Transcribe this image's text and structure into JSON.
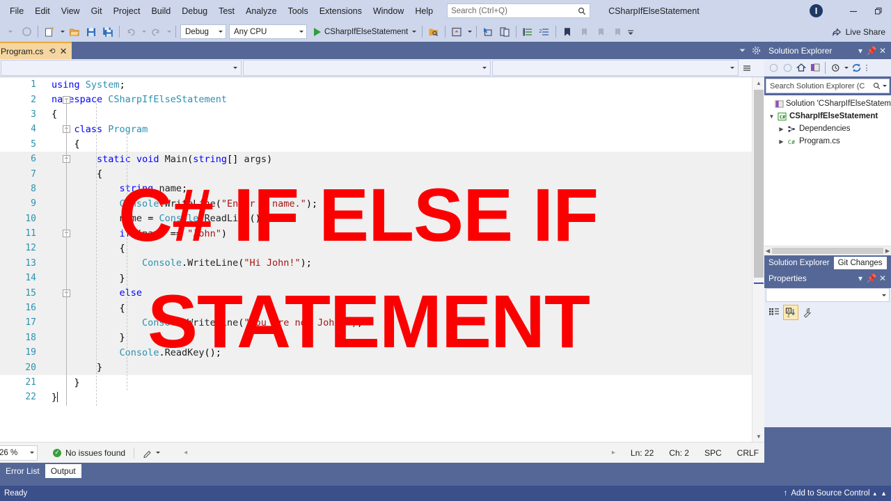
{
  "titlebar": {
    "menus": [
      "File",
      "Edit",
      "View",
      "Git",
      "Project",
      "Build",
      "Debug",
      "Test",
      "Analyze",
      "Tools",
      "Extensions",
      "Window",
      "Help"
    ],
    "search_placeholder": "Search (Ctrl+Q)",
    "solution_title": "CSharpIfElseStatement",
    "avatar_initial": "I",
    "minimize_label": "Minimize",
    "restore_label": "Restore Down"
  },
  "toolbar": {
    "config": "Debug",
    "platform": "Any CPU",
    "run_target": "CSharpIfElseStatement",
    "live_share": "Live Share"
  },
  "editor": {
    "tab_name": "Program.cs",
    "tab_pin": "⟲",
    "tab_close": "✕",
    "breadcrumb": {
      "scope": "",
      "type": "",
      "member": ""
    },
    "caret": "|",
    "lines": [
      {
        "n": "1",
        "text": "using System;",
        "hl": false
      },
      {
        "n": "2",
        "text": "namespace CSharpIfElseStatement",
        "hl": false
      },
      {
        "n": "3",
        "text": "{",
        "hl": false
      },
      {
        "n": "4",
        "text": "    class Program",
        "hl": false
      },
      {
        "n": "5",
        "text": "    {",
        "hl": false
      },
      {
        "n": "6",
        "text": "        static void Main(string[] args)",
        "hl": true
      },
      {
        "n": "7",
        "text": "        {",
        "hl": true
      },
      {
        "n": "8",
        "text": "            string name;",
        "hl": true
      },
      {
        "n": "9",
        "text": "            Console.WriteLine(\"Enter a name.\");",
        "hl": true
      },
      {
        "n": "10",
        "text": "            name = Console.ReadLine();",
        "hl": true
      },
      {
        "n": "11",
        "text": "            if (name == \"John\")",
        "hl": true
      },
      {
        "n": "12",
        "text": "            {",
        "hl": true
      },
      {
        "n": "13",
        "text": "                Console.WriteLine(\"Hi John!\");",
        "hl": true
      },
      {
        "n": "14",
        "text": "            }",
        "hl": true
      },
      {
        "n": "15",
        "text": "            else",
        "hl": true
      },
      {
        "n": "16",
        "text": "            {",
        "hl": true
      },
      {
        "n": "17",
        "text": "                Console.WriteLine(\"You are not John!\");",
        "hl": true
      },
      {
        "n": "18",
        "text": "            }",
        "hl": true
      },
      {
        "n": "19",
        "text": "            Console.ReadKey();",
        "hl": true
      },
      {
        "n": "20",
        "text": "        }",
        "hl": true
      },
      {
        "n": "21",
        "text": "    }",
        "hl": false
      },
      {
        "n": "22",
        "text": "}",
        "hl": false
      }
    ]
  },
  "editor_status": {
    "zoom": "26 %",
    "issues": "No issues found",
    "line": "Ln: 22",
    "column": "Ch: 2",
    "indent": "SPC",
    "eol": "CRLF"
  },
  "solution_explorer": {
    "title": "Solution Explorer",
    "search_placeholder": "Search Solution Explorer (C",
    "nodes": [
      {
        "label": "Solution 'CSharpIfElseStatem",
        "icon": "solution-icon",
        "depth": 0,
        "twisty": "",
        "bold": false
      },
      {
        "label": "CSharpIfElseStatement",
        "icon": "csharp-project-icon",
        "depth": 0,
        "twisty": "▼",
        "bold": true
      },
      {
        "label": "Dependencies",
        "icon": "dependencies-icon",
        "depth": 1,
        "twisty": "▶",
        "bold": false
      },
      {
        "label": "Program.cs",
        "icon": "csharp-file-icon",
        "depth": 1,
        "twisty": "▶",
        "bold": false
      }
    ],
    "dock_tabs": [
      {
        "label": "Solution Explorer",
        "active": false
      },
      {
        "label": "Git Changes",
        "active": true
      }
    ]
  },
  "properties": {
    "title": "Properties"
  },
  "bottom_panels": {
    "tabs": [
      {
        "label": "Error List",
        "active": false
      },
      {
        "label": "Output",
        "active": true
      }
    ]
  },
  "statusbar": {
    "status": "Ready",
    "source_control": "Add to Source Control",
    "arrow_up": "↑",
    "chevron_up": "▴"
  },
  "overlay": {
    "line1": "C# IF ELSE IF",
    "line2": "STATEMENT",
    "color": "#fa0000"
  },
  "colors": {
    "chrome": "#cdd6eb",
    "dock": "#546796",
    "statusbar": "#3b4f8a",
    "tab_active": "#f6d6a0",
    "tab_accent": "#e9a93c",
    "keyword": "#0000ff",
    "type": "#2b91af",
    "string": "#a31515",
    "linenum": "#2b91af"
  }
}
